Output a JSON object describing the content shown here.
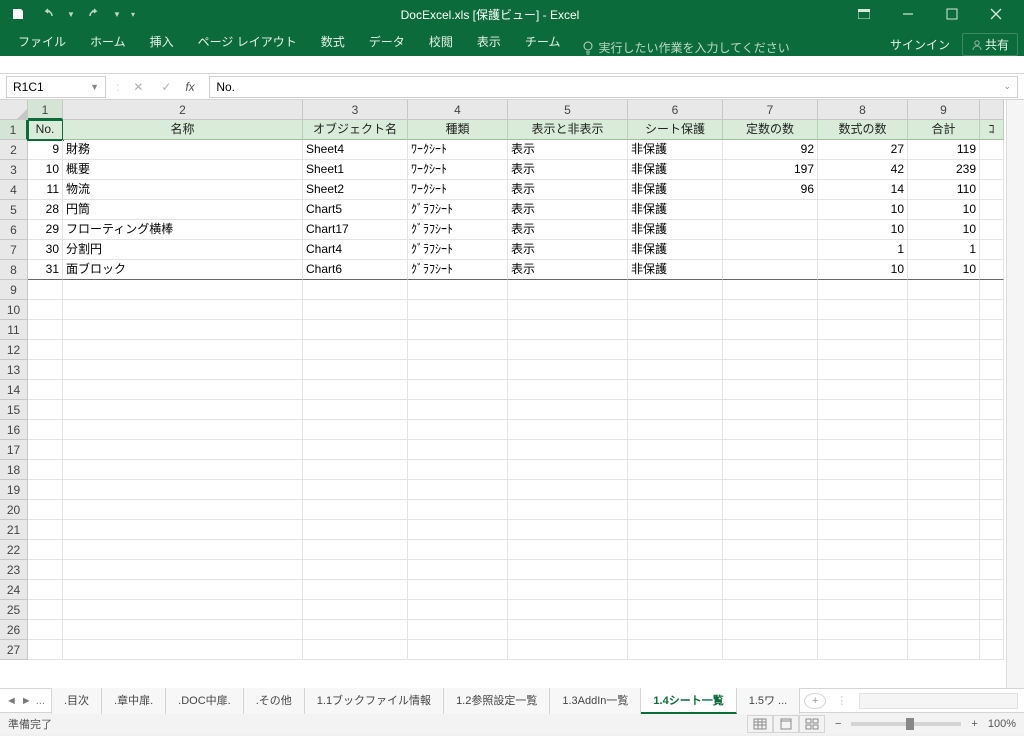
{
  "title": "DocExcel.xls [保護ビュー] - Excel",
  "qat": {
    "save": "保存",
    "undo": "元に戻す",
    "redo": "やり直し"
  },
  "ribbon": {
    "tabs": [
      "ファイル",
      "ホーム",
      "挿入",
      "ページ レイアウト",
      "数式",
      "データ",
      "校閲",
      "表示",
      "チーム"
    ],
    "tell_me": "実行したい作業を入力してください",
    "signin": "サインイン",
    "share": "共有"
  },
  "namebox": "R1C1",
  "formula": "No.",
  "columns": {
    "labels": [
      "1",
      "2",
      "3",
      "4",
      "5",
      "6",
      "7",
      "8",
      "9"
    ],
    "widths": [
      35,
      240,
      105,
      100,
      120,
      95,
      95,
      90,
      72
    ],
    "headers": [
      "No.",
      "名称",
      "オブジェクト名",
      "種類",
      "表示と非表示",
      "シート保護",
      "定数の数",
      "数式の数",
      "合計"
    ]
  },
  "partial_col": "ｺ",
  "rows": [
    {
      "no": "9",
      "name": "財務",
      "obj": "Sheet4",
      "kind": "ﾜｰｸｼｰﾄ",
      "vis": "表示",
      "prot": "非保護",
      "const": "92",
      "form": "27",
      "total": "119"
    },
    {
      "no": "10",
      "name": "概要",
      "obj": "Sheet1",
      "kind": "ﾜｰｸｼｰﾄ",
      "vis": "表示",
      "prot": "非保護",
      "const": "197",
      "form": "42",
      "total": "239"
    },
    {
      "no": "11",
      "name": "物流",
      "obj": "Sheet2",
      "kind": "ﾜｰｸｼｰﾄ",
      "vis": "表示",
      "prot": "非保護",
      "const": "96",
      "form": "14",
      "total": "110"
    },
    {
      "no": "28",
      "name": "円筒",
      "obj": "Chart5",
      "kind": "ｸﾞﾗﾌｼｰﾄ",
      "vis": "表示",
      "prot": "非保護",
      "const": "",
      "form": "10",
      "total": "10"
    },
    {
      "no": "29",
      "name": "フローティング横棒",
      "obj": "Chart17",
      "kind": "ｸﾞﾗﾌｼｰﾄ",
      "vis": "表示",
      "prot": "非保護",
      "const": "",
      "form": "10",
      "total": "10"
    },
    {
      "no": "30",
      "name": "分割円",
      "obj": "Chart4",
      "kind": "ｸﾞﾗﾌｼｰﾄ",
      "vis": "表示",
      "prot": "非保護",
      "const": "",
      "form": "1",
      "total": "1"
    },
    {
      "no": "31",
      "name": "面ブロック",
      "obj": "Chart6",
      "kind": "ｸﾞﾗﾌｼｰﾄ",
      "vis": "表示",
      "prot": "非保護",
      "const": "",
      "form": "10",
      "total": "10"
    }
  ],
  "row_count": 27,
  "sheet_tabs": {
    "overflow": "...",
    "tabs": [
      ".目次",
      ".章中扉.",
      ".DOC中扉.",
      ".その他",
      "1.1ブックファイル情報",
      "1.2参照設定一覧",
      "1.3AddIn一覧",
      "1.4シート一覧",
      "1.5ワ ..."
    ],
    "active": 7
  },
  "status": {
    "ready": "準備完了",
    "zoom": "100%"
  }
}
